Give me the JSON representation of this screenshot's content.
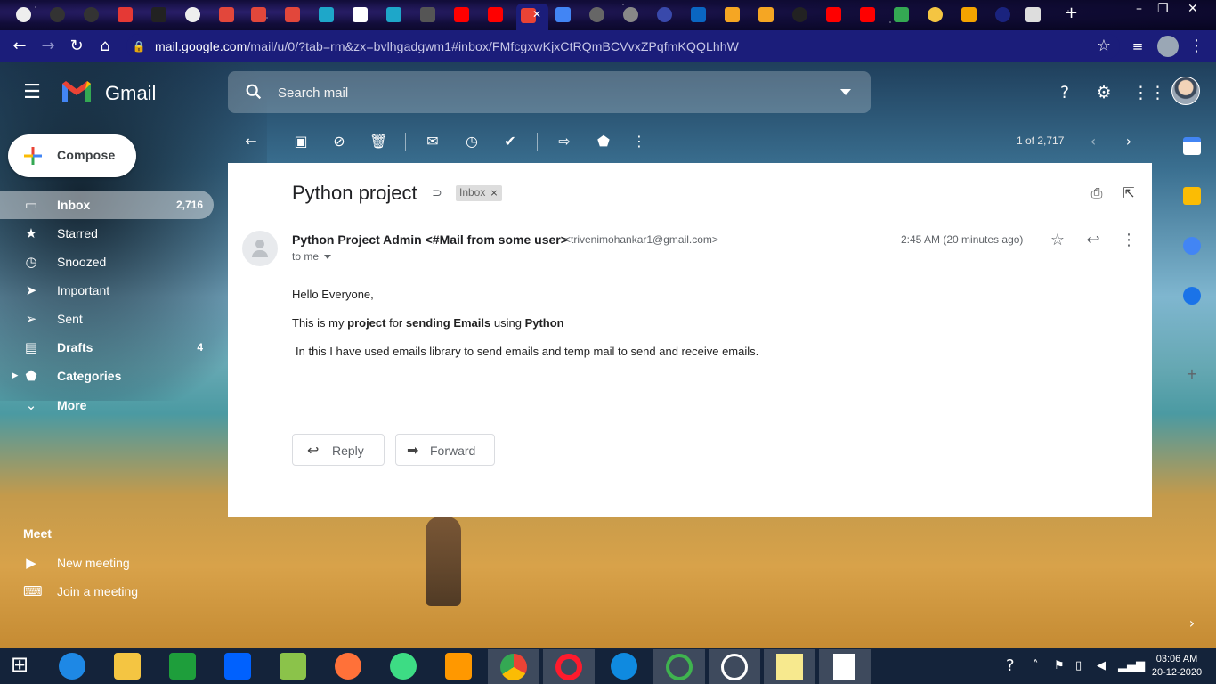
{
  "browser": {
    "url_host": "mail.google.com",
    "url_path": "/mail/u/0/?tab=rm&zx=bvlhgadgwm1#inbox/FMfcgxwKjxCtRQmBCVvxZPqfmKQQLhhW"
  },
  "header": {
    "app_name": "Gmail",
    "search_placeholder": "Search mail"
  },
  "sidebar": {
    "compose_label": "Compose",
    "items": [
      {
        "label": "Inbox",
        "count": "2,716",
        "icon": "inbox-icon"
      },
      {
        "label": "Starred",
        "count": "",
        "icon": "star-icon"
      },
      {
        "label": "Snoozed",
        "count": "",
        "icon": "clock-icon"
      },
      {
        "label": "Important",
        "count": "",
        "icon": "important-icon"
      },
      {
        "label": "Sent",
        "count": "",
        "icon": "send-icon"
      },
      {
        "label": "Drafts",
        "count": "4",
        "icon": "draft-icon"
      },
      {
        "label": "Categories",
        "count": "",
        "icon": "label-icon"
      },
      {
        "label": "More",
        "count": "",
        "icon": "chevron-down-icon"
      }
    ],
    "meet": {
      "title": "Meet",
      "new_meeting": "New meeting",
      "join_meeting": "Join a meeting"
    }
  },
  "toolbar": {
    "pager": "1 of 2,717"
  },
  "email": {
    "subject": "Python project",
    "label": "Inbox",
    "sender_name": "Python Project Admin <#Mail from some user>",
    "sender_email": "<trivenimohankar1@gmail.com>",
    "recipient": "to me",
    "time": "2:45 AM (20 minutes ago)",
    "greeting": "Hello Everyone,",
    "line2": {
      "p1": "This is my ",
      "b1": "project",
      "p2": " for ",
      "b2": "sending Emails",
      "p3": " using ",
      "b3": "Python"
    },
    "line3": "In this I have used emails library to send emails and temp mail to send and receive emails.",
    "reply_label": "Reply",
    "forward_label": "Forward"
  },
  "taskbar": {
    "time": "03:06 AM",
    "date": "20-12-2020"
  },
  "colors": {
    "browser_bar": "#1b1d7a",
    "taskbar": "#14233a",
    "gmail_red": "#ea4335"
  }
}
